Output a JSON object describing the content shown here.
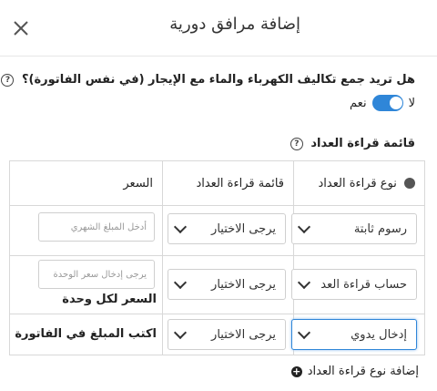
{
  "modal": {
    "title": "إضافة مرافق دورية",
    "close_icon": "close-icon"
  },
  "question": {
    "text": "هل تريد جمع تكاليف الكهرباء والماء مع الإيجار (في نفس الفاتورة)؟",
    "help_icon": "question-icon",
    "yes_label": "نعم",
    "no_label": "لا",
    "toggle_on": true
  },
  "meter_section": {
    "label": "قائمة قراءة العداد",
    "help_icon": "question-icon"
  },
  "table": {
    "headers": {
      "type": "نوع قراءة العداد",
      "list": "قائمة قراءة العداد",
      "price": "السعر"
    },
    "rows": [
      {
        "type_value": "رسوم ثابتة",
        "list_value": "يرجى الاختيار",
        "price_placeholder": "أدخل المبلغ الشهري",
        "price_note": ""
      },
      {
        "type_value": "حساب قراءة العد",
        "list_value": "يرجى الاختيار",
        "price_placeholder": "يرجى إدخال سعر الوحدة",
        "price_note": "السعر لكل وحدة"
      },
      {
        "type_value": "إدخال يدوي",
        "list_value": "يرجى الاختيار",
        "price_placeholder": "",
        "price_note": "اكتب المبلغ في الفاتورة"
      }
    ]
  },
  "add_button": {
    "label": "إضافة نوع قراءة العداد",
    "icon": "plus-circle-icon"
  },
  "colors": {
    "accent": "#2f86d8",
    "border": "#d8d8d8"
  }
}
